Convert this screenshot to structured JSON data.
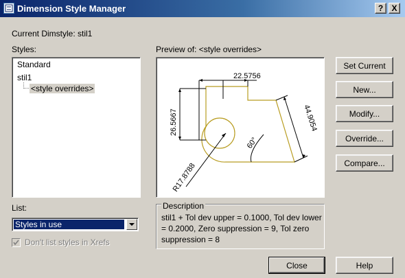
{
  "window": {
    "title": "Dimension Style Manager",
    "help_button": "?",
    "close_button": "X"
  },
  "current_dimstyle": "Current Dimstyle: stil1",
  "styles_label": "Styles:",
  "styles": {
    "items": [
      {
        "label": "Standard"
      },
      {
        "label": "stil1"
      },
      {
        "label": "<style overrides>",
        "selected": true
      }
    ]
  },
  "preview": {
    "label": "Preview of: <style overrides>",
    "dimensions": {
      "top": "22.5756",
      "left": "26.5667",
      "right": "44.9054",
      "angle": "60°",
      "radius": "R17.8788"
    }
  },
  "list": {
    "label": "List:",
    "selected": "Styles in use"
  },
  "xrefs_checkbox": {
    "label": "Don't list styles in Xrefs",
    "checked": true,
    "disabled": true
  },
  "description": {
    "title": "Description",
    "text": "stil1 + Tol dev upper = 0.1000, Tol dev lower = 0.2000, Zero suppression = 9, Tol zero suppression = 8"
  },
  "buttons": {
    "set_current": "Set Current",
    "new": "New...",
    "modify": "Modify...",
    "override": "Override...",
    "compare": "Compare...",
    "close": "Close",
    "help": "Help"
  },
  "colors": {
    "title_bar": "#0a246a",
    "dialog_bg": "#d4d0c8",
    "preview_geometry": "#b89c20",
    "selection": "#0a246a"
  }
}
